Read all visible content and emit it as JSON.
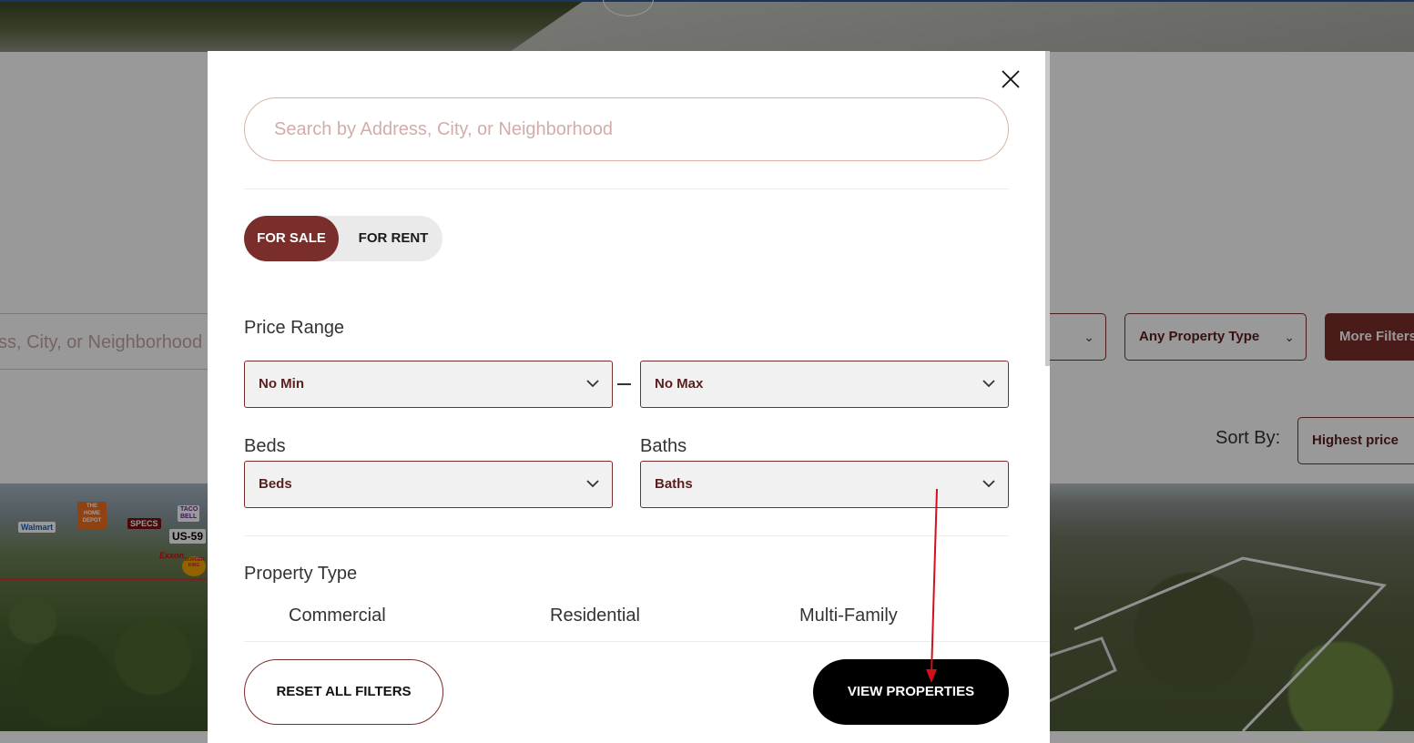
{
  "background": {
    "search_placeholder": "ss, City, or Neighborhood",
    "property_type_filter": "Any Property Type",
    "more_filters": "More Filters",
    "sort_label": "Sort By:",
    "sort_value": "Highest price",
    "logos": [
      "Walmart",
      "THE HOME DEPOT",
      "SPECS",
      "TACO BELL",
      "US-59",
      "Exxon",
      "BURGER KING"
    ]
  },
  "modal": {
    "search": {
      "placeholder": "Search by Address, City, or Neighborhood",
      "value": ""
    },
    "listing_toggle": {
      "active": "FOR SALE",
      "inactive": "FOR RENT"
    },
    "price_range": {
      "label": "Price Range",
      "min": "No Min",
      "max": "No Max"
    },
    "beds": {
      "label": "Beds",
      "value": "Beds"
    },
    "baths": {
      "label": "Baths",
      "value": "Baths"
    },
    "property_type": {
      "label": "Property Type",
      "options": [
        "Commercial",
        "Residential",
        "Multi-Family"
      ]
    },
    "buttons": {
      "reset": "RESET ALL FILTERS",
      "view": "VIEW PROPERTIES"
    }
  },
  "colors": {
    "brand": "#7a2e2b",
    "annotation": "#d0101a"
  }
}
